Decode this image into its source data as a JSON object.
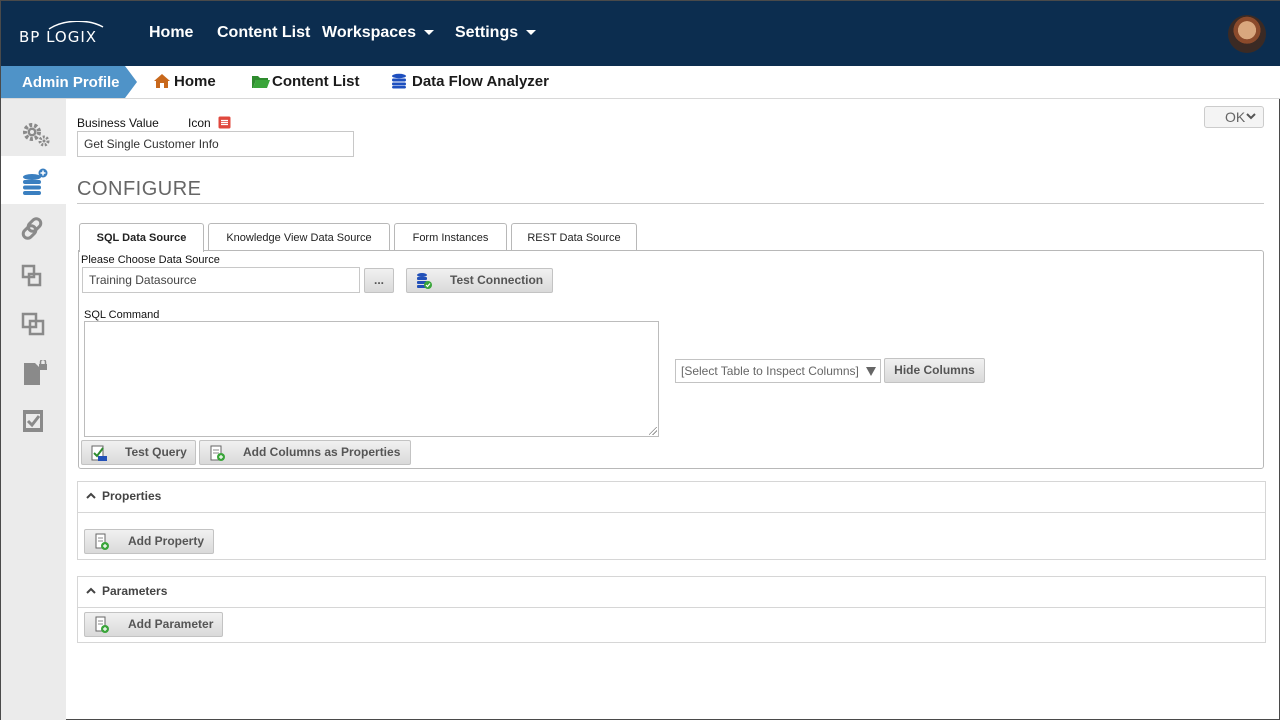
{
  "topnav": {
    "logo": "BP LOGIX",
    "items": [
      {
        "label": "Home"
      },
      {
        "label": "Content List"
      },
      {
        "label": "Workspaces"
      },
      {
        "label": "Settings"
      }
    ]
  },
  "breadcrumb": {
    "admin_profile": "Admin Profile",
    "items": [
      {
        "label": "Home",
        "icon": "home-icon"
      },
      {
        "label": "Content List",
        "icon": "folder-icon"
      },
      {
        "label": "Data Flow Analyzer",
        "icon": "database-icon"
      }
    ]
  },
  "sidebar": {
    "items": [
      "gears-icon",
      "database-add-icon",
      "link-icon",
      "connect-icon",
      "copy-icon",
      "document-lock-icon",
      "checklist-icon"
    ],
    "active_index": 1
  },
  "form": {
    "business_value_label": "Business Value",
    "icon_label": "Icon",
    "business_value": "Get Single Customer Info",
    "ok_label": "OK"
  },
  "configure": {
    "title": "CONFIGURE",
    "tabs": [
      {
        "label": "SQL Data Source",
        "active": true
      },
      {
        "label": "Knowledge View Data Source"
      },
      {
        "label": "Form Instances"
      },
      {
        "label": "REST Data Source"
      }
    ],
    "data_source_label": "Please Choose Data Source",
    "data_source_value": "Training Datasource",
    "browse_label": "...",
    "test_connection_label": "Test Connection",
    "sql_command_label": "SQL Command",
    "sql_command_value": "",
    "table_select_value": "[Select Table to Inspect Columns]",
    "hide_columns_label": "Hide Columns",
    "test_query_label": "Test Query",
    "add_columns_label": "Add Columns as Properties"
  },
  "properties": {
    "title": "Properties",
    "add_label": "Add Property"
  },
  "parameters": {
    "title": "Parameters",
    "add_label": "Add Parameter"
  },
  "colors": {
    "navbar": "#0c2d4f",
    "breadcrumb_accent": "#4f93c8",
    "sidebar_bg": "#ebebeb",
    "icon_gray": "#8a8a8a",
    "icon_blue": "#3a7fc0",
    "home_orange": "#c8681c",
    "folder_green": "#2e8b2e"
  }
}
